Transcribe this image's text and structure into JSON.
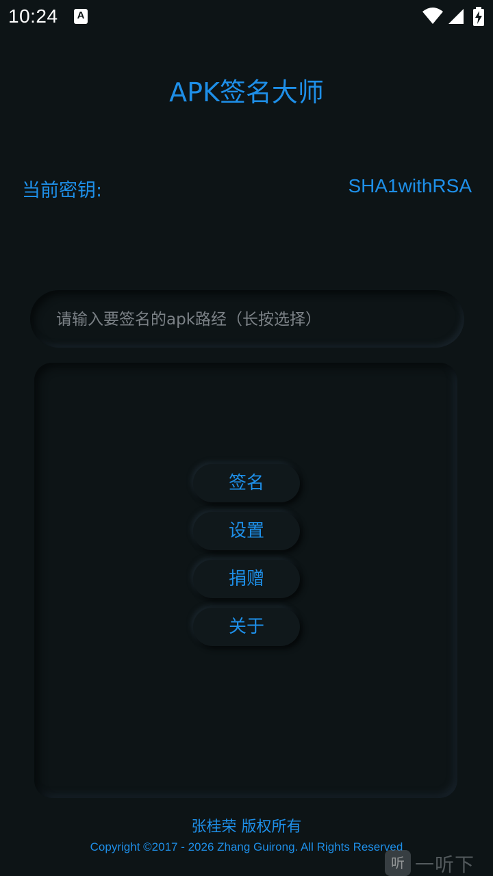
{
  "status_bar": {
    "time": "10:24",
    "notification_glyph": "A",
    "icons": [
      "wifi-icon",
      "signal-icon",
      "battery-charging-icon"
    ]
  },
  "app": {
    "title": "APK签名大师"
  },
  "key": {
    "label": "当前密钥:",
    "value": "SHA1withRSA"
  },
  "path_input": {
    "value": "",
    "placeholder": "请输入要签名的apk路经（长按选择）"
  },
  "menu": {
    "sign_label": "签名",
    "settings_label": "设置",
    "donate_label": "捐赠",
    "about_label": "关于"
  },
  "footer": {
    "author": "张桂荣  版权所有",
    "copyright": "Copyright ©2017 - 2026 Zhang Guirong. All Rights Reserved"
  },
  "watermark": {
    "logo_glyph": "听",
    "text": "一听下载"
  },
  "colors": {
    "background": "#0d1416",
    "accent": "#1e8fe8",
    "placeholder": "#7b8186"
  }
}
